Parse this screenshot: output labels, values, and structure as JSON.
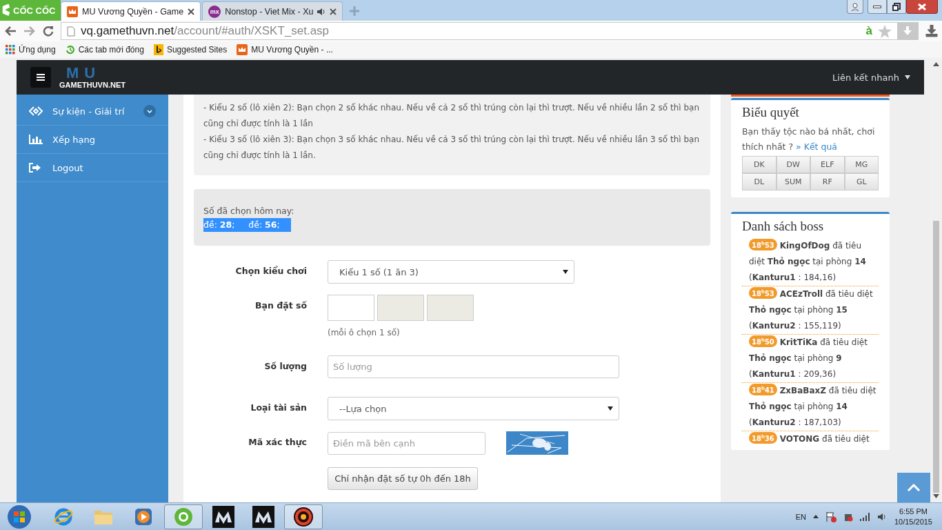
{
  "browser": {
    "logo": "CỐC CỐC",
    "tabs": [
      {
        "title": "MU Vương Quyền - Game",
        "selected": true,
        "audio": false
      },
      {
        "title": "Nonstop - Viet Mix - Xu",
        "favicon_text": "mx",
        "selected": false,
        "audio": true
      }
    ],
    "address": {
      "host": "vq.gamethuvn.net",
      "path": "/account/#auth/XSKT_set.asp",
      "badge": "à"
    },
    "bookmarks": [
      "Ứng dụng",
      "Các tab mới đóng",
      "Suggested Sites",
      "MU Vương Quyền - ..."
    ]
  },
  "navbar": {
    "logo_mark": "MU",
    "logo": "GAMETHUVN.NET",
    "quick_links": "Liên kết nhanh"
  },
  "sidebar": {
    "items": [
      {
        "label": "Sự kiện - Giải trí",
        "kind": "group"
      },
      {
        "label": "Xếp hạng",
        "kind": "link"
      },
      {
        "label": "Logout",
        "kind": "link"
      }
    ]
  },
  "rules": [
    "- Kiểu 2 số (lô xiên 2): Bạn chọn 2 số khác nhau. Nếu về cả 2 số thì trúng còn lại thì trượt. Nếu về nhiều lần 2 số thì bạn cũng chỉ được tính là 1 lần",
    "- Kiểu 3 số (lô xiên 3): Bạn chọn 3 số khác nhau. Nếu về cả 3 số thì trúng còn lại thì trượt. Nếu về nhiều lần 3 số thì bạn cũng chỉ được tính là 1 lần."
  ],
  "chosen": {
    "label": "Số đã chọn hôm nay:",
    "value": "đề: **28**;     đề: **56**;"
  },
  "form": {
    "rows": [
      {
        "label": "Chọn kiểu chơi",
        "kind": "select",
        "value": "Kiểu 1 số (1 ăn 3)"
      },
      {
        "label": "Bạn đặt số",
        "kind": "digits",
        "boxes": [
          {
            "disabled": false
          },
          {
            "disabled": true
          },
          {
            "disabled": true
          }
        ],
        "hint": "(mỗi ô chọn 1 số)"
      },
      {
        "label": "Số lượng",
        "kind": "input",
        "placeholder": "Số lượng"
      },
      {
        "label": "Loại tài sản",
        "kind": "select",
        "value": "--Lựa chọn"
      },
      {
        "label": "Mã xác thực",
        "kind": "captcha",
        "placeholder": "Điền mã bên cạnh"
      }
    ],
    "button": "Chỉ nhận đặt số tự 0h đến 18h"
  },
  "vote": {
    "title": "Biểu quyết",
    "question": "Bạn thấy tộc nào bá nhất, chơi thích nhất ?",
    "link": "» Kết quả",
    "options": [
      "DK",
      "DW",
      "ELF",
      "MG",
      "DL",
      "SUM",
      "RF",
      "GL"
    ]
  },
  "boss": {
    "title": "Danh sách boss",
    "entries": [
      {
        "time": "18$^{h}$53",
        "text": "**KingOfDog** đã tiêu diệt **Thỏ ngọc** tại phòng **14** (**Kanturu1** : 184,16)"
      },
      {
        "time": "18$^{h}$53",
        "text": "**ACEzTroll** đã tiêu diệt **Thỏ ngọc** tại phòng **15** (**Kanturu2** : 155,119)"
      },
      {
        "time": "18$^{h}$50",
        "text": "**KritTiKa** đã tiêu diệt **Thỏ ngọc** tại phòng **9** (**Kanturu1** : 209,36)"
      },
      {
        "time": "18$^{h}$41",
        "text": "**ZxBaBaxZ** đã tiêu diệt **Thỏ ngọc** tại phòng **14** (**Kanturu2** : 187,103)"
      },
      {
        "time": "18$^{h}$36",
        "text": "**VOTONG** đã tiêu diệt"
      }
    ]
  },
  "taskbar": {
    "apps": [
      {
        "kind": "ie",
        "selected": false
      },
      {
        "kind": "folder",
        "selected": false
      },
      {
        "kind": "media",
        "selected": false
      },
      {
        "kind": "coccoc",
        "selected": true
      },
      {
        "kind": "mu",
        "selected": false
      },
      {
        "kind": "mu",
        "selected": false
      },
      {
        "kind": "ring",
        "selected": true
      }
    ],
    "language": "EN",
    "time": "6:55 PM",
    "date": "10/15/2015"
  }
}
